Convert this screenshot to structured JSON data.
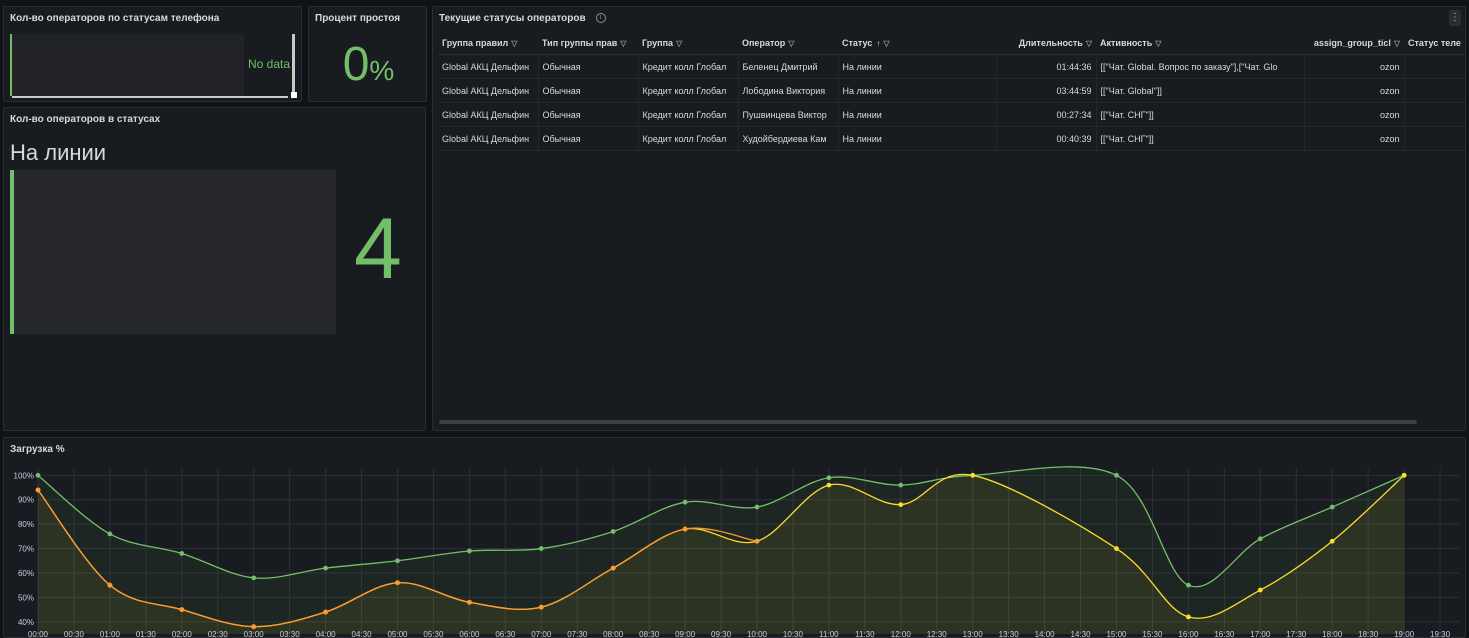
{
  "phone_status_panel": {
    "title": "Кол-во операторов по статусам телефона",
    "no_data": "No data"
  },
  "idle_panel": {
    "title": "Процент простоя",
    "value": "0",
    "unit": "%"
  },
  "status_count_panel": {
    "title": "Кол-во операторов в статусах",
    "label": "На линии",
    "value": "4",
    "color": "#73bf69"
  },
  "table_panel": {
    "title": "Текущие статусы операторов",
    "columns": [
      "Группа правил",
      "Тип группы прав",
      "Группа",
      "Оператор",
      "Статус",
      "Длительность",
      "Активность",
      "assign_group_ticl",
      "Статус теле"
    ],
    "rows": [
      [
        "Global АКЦ Дельфин",
        "Обычная",
        "Кредит колл Глобал",
        "Беленец Дмитрий",
        "На линии",
        "01:44:36",
        "[[\"Чат. Global. Вопрос по заказу\"],[\"Чат. Glo",
        "ozon",
        ""
      ],
      [
        "Global АКЦ Дельфин",
        "Обычная",
        "Кредит колл Глобал",
        "Лободина Виктория",
        "На линии",
        "03:44:59",
        "[[\"Чат. Global\"]]",
        "ozon",
        ""
      ],
      [
        "Global АКЦ Дельфин",
        "Обычная",
        "Кредит колл Глобал",
        "Пушвинцева Виктор",
        "На линии",
        "00:27:34",
        "[[\"Чат. СНГ\"]]",
        "ozon",
        ""
      ],
      [
        "Global АКЦ Дельфин",
        "Обычная",
        "Кредит колл Глобал",
        "Худойбердиева Кам",
        "На линии",
        "00:40:39",
        "[[\"Чат. СНГ\"]]",
        "ozon",
        ""
      ]
    ]
  },
  "chart_panel": {
    "title": "Загрузка %"
  },
  "chart_data": {
    "type": "line",
    "x": [
      "00:00",
      "00:30",
      "01:00",
      "01:30",
      "02:00",
      "02:30",
      "03:00",
      "03:30",
      "04:00",
      "04:30",
      "05:00",
      "05:30",
      "06:00",
      "06:30",
      "07:00",
      "07:30",
      "08:00",
      "08:30",
      "09:00",
      "09:30",
      "10:00",
      "10:30",
      "11:00",
      "11:30",
      "12:00",
      "12:30",
      "13:00",
      "13:30",
      "14:00",
      "14:30",
      "15:00",
      "15:30",
      "16:00",
      "16:30",
      "17:00",
      "17:30",
      "18:00",
      "18:30",
      "19:00",
      "19:30"
    ],
    "y_ticks": [
      "40%",
      "50%",
      "60%",
      "70%",
      "80%",
      "90%",
      "100%"
    ],
    "ylim": [
      35,
      103
    ],
    "series": [
      {
        "color": "#73bf69",
        "points": [
          [
            0,
            100
          ],
          [
            2,
            76
          ],
          [
            4,
            68
          ],
          [
            6,
            58
          ],
          [
            8,
            62
          ],
          [
            10,
            65
          ],
          [
            12,
            69
          ],
          [
            14,
            70
          ],
          [
            16,
            77
          ],
          [
            18,
            89
          ],
          [
            20,
            87
          ],
          [
            22,
            99
          ],
          [
            24,
            96
          ],
          [
            26,
            100
          ],
          [
            30,
            100
          ],
          [
            32,
            55
          ],
          [
            34,
            74
          ],
          [
            36,
            87
          ],
          [
            38,
            100
          ]
        ]
      },
      {
        "color": "#fade2a",
        "points": [
          [
            0,
            94
          ],
          [
            2,
            55
          ],
          [
            4,
            45
          ],
          [
            6,
            38
          ],
          [
            8,
            44
          ],
          [
            10,
            56
          ],
          [
            12,
            48
          ],
          [
            14,
            46
          ],
          [
            16,
            62
          ],
          [
            18,
            78
          ],
          [
            20,
            73
          ],
          [
            22,
            96
          ],
          [
            24,
            88
          ],
          [
            26,
            100
          ],
          [
            30,
            70
          ],
          [
            32,
            42
          ],
          [
            34,
            53
          ],
          [
            36,
            73
          ],
          [
            38,
            100
          ]
        ]
      },
      {
        "color": "#ff9830",
        "points": [
          [
            0,
            94
          ],
          [
            2,
            55
          ],
          [
            4,
            45
          ],
          [
            6,
            38
          ],
          [
            8,
            44
          ],
          [
            10,
            56
          ],
          [
            12,
            48
          ],
          [
            14,
            46
          ],
          [
            16,
            62
          ],
          [
            18,
            78
          ],
          [
            20,
            73
          ]
        ]
      }
    ]
  }
}
